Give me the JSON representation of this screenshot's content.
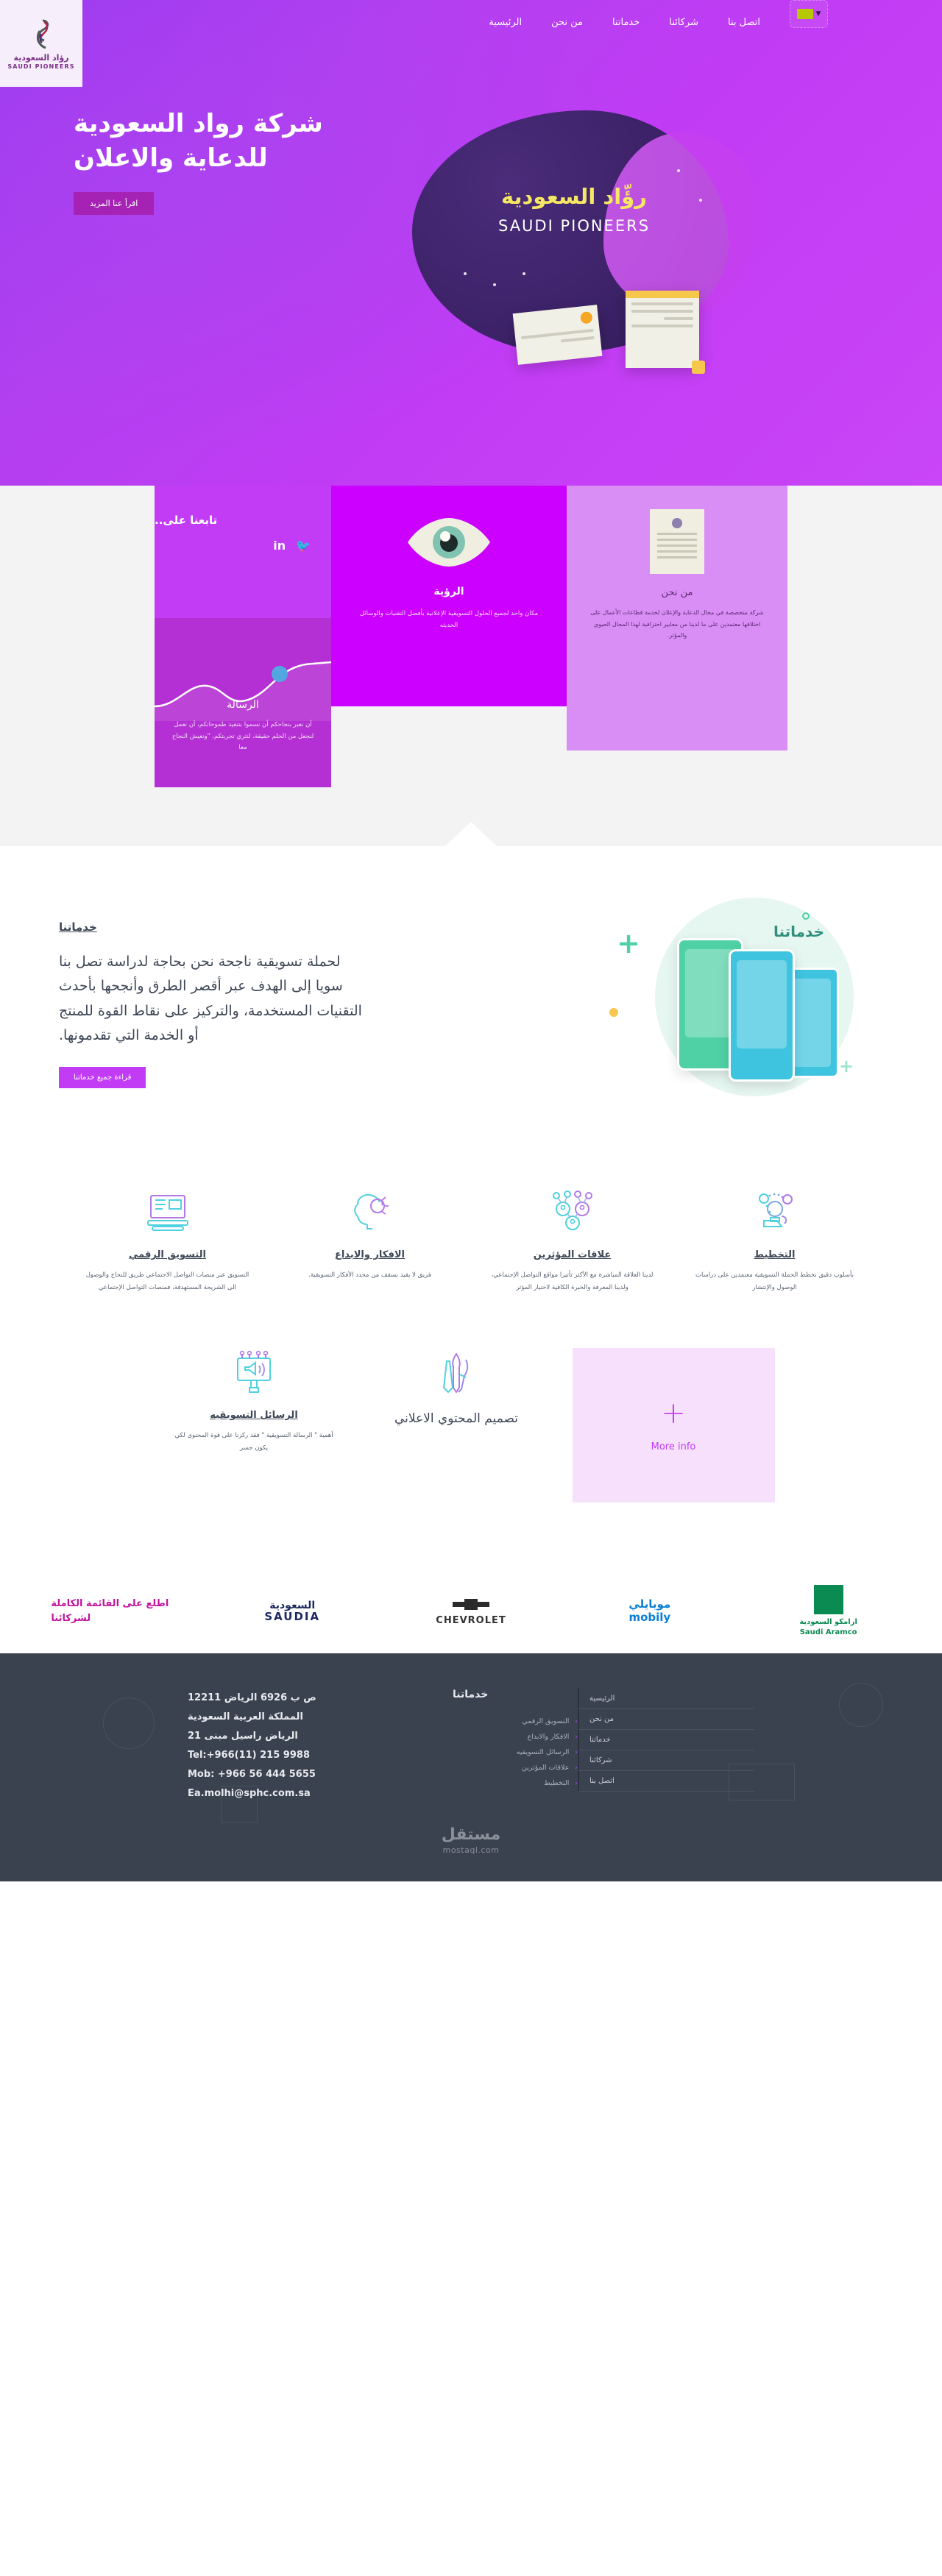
{
  "header": {
    "nav": [
      {
        "label": "الرئيسية",
        "name": "nav-home"
      },
      {
        "label": "من نحن",
        "name": "nav-about"
      },
      {
        "label": "خدماتنا",
        "name": "nav-services"
      },
      {
        "label": "شركائنا",
        "name": "nav-partners"
      },
      {
        "label": "اتصل بنا",
        "name": "nav-contact"
      }
    ],
    "lang_switcher": "lang-flag",
    "logo": {
      "arabic": "رؤاد السعودية",
      "english": "SAUDI PIONEERS"
    }
  },
  "hero": {
    "title": "شركة رواد السعودية للدعاية والاعلان",
    "cta": "اقرأ عنا المزيد",
    "badge_arabic": "رؤّاد السعودية",
    "badge_english": "SAUDI PIONEERS"
  },
  "feature_cards": {
    "social": {
      "title": "تابعنا على..",
      "icons": [
        "in",
        "twitter-icon"
      ]
    },
    "message": {
      "title": "الرسالة",
      "body": "أن نعبر بنجاحكم أن نسموا بتنفيذ طموحاتكم، أن نعمل لنجعل من الحلم حقيقة، لنثري تجربتكم، \"ونعيش النجاح معا"
    },
    "vision": {
      "title": "الرؤية",
      "body": "مكان واحد لجميع الحلول التسويقية الإعلانية بأفضل التقنيات والوسائل الحديثه"
    },
    "about": {
      "title": "من نحن",
      "body": "شركة متخصصة في مجال الدعاية والإعلان لخدمة قطاعات الأعمال على اختلافها معتمدين على ما لدينا من معايير احترافية لهذا المجال الحيوي والمؤثر."
    }
  },
  "services_intro": {
    "heading": "خدماتنا",
    "body": "لحملة تسويقية ناجحة نحن بحاجة لدراسة تصل بنا سويا إلى الهدف عبر أقصر الطرق وأنجحها بأحدث التقنيات المستخدمة، والتركيز على نقاط القوة للمنتج أو الخدمة التي تقدمونها.",
    "cta": "قراءة جميع خدماتنا",
    "art_title": "خدماتنا"
  },
  "services_row1": [
    {
      "title": "التسويق الرقمي",
      "desc": "التسويق عبر منصات التواصل الاجتماعي طريق للنجاح والوصول الى الشريحة المستهدفة، فمنصات التواصل الإجتماعي",
      "icon": "digital-marketing-icon"
    },
    {
      "title": "الافكار والابداع",
      "desc": "فريق لا يقيد بسقف من محدد الأفكار التسويقية.",
      "icon": "idea-brain-icon"
    },
    {
      "title": "علاقات المؤثرين",
      "desc": "لدينا العلاقة المباشرة مع الأكثر تأثيرا مواقع التواصل الإجتماعي، ولدينا المعرفة والخبرة الكافية لاختيار المؤثر",
      "icon": "influencer-network-icon"
    },
    {
      "title": "التخطيط",
      "desc": "بأسلوب دقيق نخطط الحملة التسويقية معتمدين على دراسات الوصول والإنتشار",
      "icon": "planning-bulb-icon"
    }
  ],
  "services_row2": [
    {
      "title": "الرسائل التسويقيه",
      "desc": "أهمية \" الرسالة التسويقية \" فقد ركزنا على قوة المحتوى لكي يكون جسر",
      "icon": "megaphone-billboard-icon"
    },
    {
      "title": "تصميم المحتوي الاعلاني",
      "desc": "",
      "icon": "design-tools-icon"
    }
  ],
  "more_card": {
    "plus": "+",
    "label": "More info"
  },
  "partners": {
    "cta": "اطلع على القائمة الكاملة لشركائنا",
    "logos": [
      {
        "name": "saudia-logo",
        "ar": "السعودية",
        "en": "SAUDIA"
      },
      {
        "name": "chevrolet-logo",
        "en": "CHEVROLET"
      },
      {
        "name": "mobily-logo",
        "ar": "موبايلي",
        "en": "mobily"
      },
      {
        "name": "saudi-aramco-logo",
        "ar": "ارامكو السعودية",
        "en": "Saudi Aramco"
      }
    ]
  },
  "footer": {
    "contact": {
      "line1": "ص ب 6926 الرياض 12211",
      "line2": "المملكة العربية السعودية",
      "line3": "الرياض راسيل مبنى 21",
      "line4": "Tel:+966(11) 215 9988",
      "line5": "Mob: +966 56 444 5655",
      "line6": "Ea.molhi@sphc.com.sa"
    },
    "services_title": "خدماتنا",
    "services": [
      "التسويق الرقمي",
      "الافكار والابداع",
      "الرسائل التسويقيه",
      "علاقات المؤثرين",
      "التخطيط"
    ],
    "nav": [
      "الرئيسية",
      "من نحن",
      "خدماتنا",
      "شركائنا",
      "اتصل بنا"
    ],
    "watermark": "مستقل",
    "watermark_sub": "mostaql.com"
  },
  "colors": {
    "primary": "#c23cf5",
    "magenta": "#cc00ff",
    "deep_purple": "#3b2166",
    "footer_bg": "#3a4250",
    "accent_pink": "#c2149e"
  }
}
